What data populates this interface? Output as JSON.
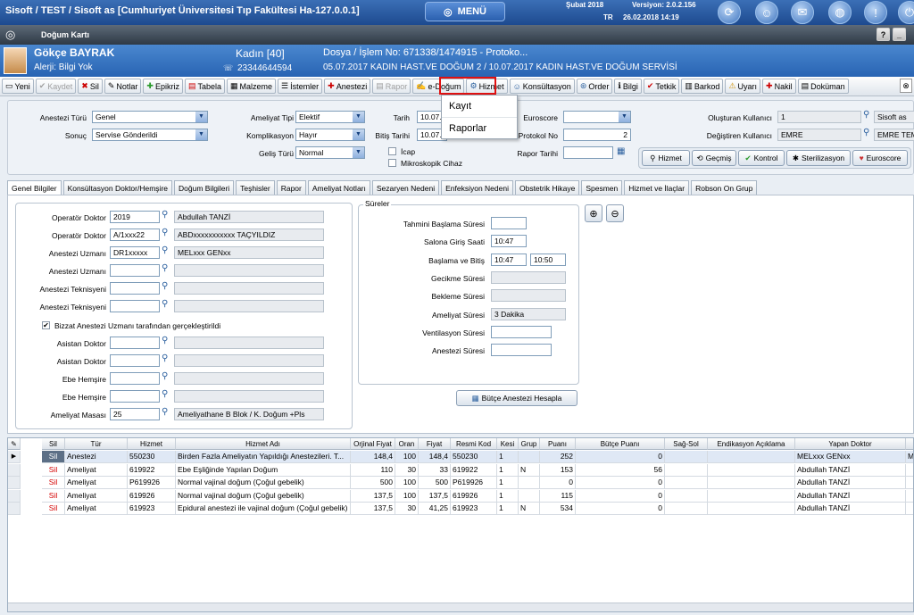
{
  "topbar": {
    "title": "Sisoft / TEST / Sisoft as [Cumhuriyet Üniversitesi Tıp Fakültesi Ha-127.0.0.1]",
    "menu_label": "MENÜ",
    "month": "Şubat 2018",
    "version": "Versiyon: 2.0.2.156",
    "lang": "TR",
    "datetime": "26.02.2018  14:19"
  },
  "window": {
    "title": "Doğum Kartı"
  },
  "patient": {
    "name": "Gökçe BAYRAK",
    "allergy": "Alerji: Bilgi Yok",
    "gender_age": "Kadın [40]",
    "phone": "23344644594",
    "file": "Dosya / İşlem No: 671338/1474915 - Protoko...",
    "service": "05.07.2017 KADIN HAST.VE DOĞUM 2 / 10.07.2017 KADIN HAST.VE DOĞUM SERVİSİ"
  },
  "toolbar": [
    {
      "label": "Yeni",
      "icon": "new-icon",
      "dis": false
    },
    {
      "label": "Kaydet",
      "icon": "save-icon",
      "dis": true
    },
    {
      "label": "Sil",
      "icon": "delete-icon",
      "dis": false
    },
    {
      "label": "Notlar",
      "icon": "notes-icon",
      "dis": false
    },
    {
      "label": "Epikriz",
      "icon": "epicrisis-icon",
      "dis": false
    },
    {
      "label": "Tabela",
      "icon": "chart-icon",
      "dis": false
    },
    {
      "label": "Malzeme",
      "icon": "material-icon",
      "dis": false
    },
    {
      "label": "İstemler",
      "icon": "request-icon",
      "dis": false
    },
    {
      "label": "Anestezi",
      "icon": "anesthesia-icon",
      "dis": false
    },
    {
      "label": "Rapor",
      "icon": "report-icon",
      "dis": true
    },
    {
      "label": "e-Doğum",
      "icon": "edogum-icon",
      "dis": false
    },
    {
      "label": "Hizmet",
      "icon": "service-icon",
      "dis": false
    },
    {
      "label": "Konsültasyon",
      "icon": "consult-icon",
      "dis": false
    },
    {
      "label": "Order",
      "icon": "order-icon",
      "dis": false
    },
    {
      "label": "Bilgi",
      "icon": "info-icon",
      "dis": false
    },
    {
      "label": "Tetkik",
      "icon": "test-icon",
      "dis": false
    },
    {
      "label": "Barkod",
      "icon": "barcode-icon",
      "dis": false
    },
    {
      "label": "Uyarı",
      "icon": "warning-icon",
      "dis": false
    },
    {
      "label": "Nakil",
      "icon": "transfer-icon",
      "dis": false
    },
    {
      "label": "Doküman",
      "icon": "document-icon",
      "dis": false
    }
  ],
  "dropdown": [
    "Kayıt",
    "Raporlar"
  ],
  "form": {
    "anestezi_turu_label": "Anestezi Türü",
    "anestezi_turu": "Genel",
    "sonuc_label": "Sonuç",
    "sonuc": "Servise Gönderildi",
    "ameliyat_tipi_label": "Ameliyat Tipi",
    "ameliyat_tipi": "Elektif",
    "komplikasyon_label": "Komplikasyon",
    "komplikasyon": "Hayır",
    "gelis_turu_label": "Geliş Türü",
    "gelis_turu": "Normal",
    "tarih_label": "Tarih",
    "tarih": "10.07.",
    "bitis_label": "Bitiş Tarihi",
    "bitis": "10.07.",
    "icap": "İcap",
    "mikroskopik": "Mikroskopik Cihaz",
    "euroscore_label": "Euroscore",
    "protokol_label": "Protokol No",
    "protokol": "2",
    "rapor_tarihi_label": "Rapor Tarihi",
    "olusturan_label": "Oluşturan Kullanıcı",
    "olusturan": "1",
    "olusturan_name": "Sisoft as",
    "degistiren_label": "Değiştiren Kullanıcı",
    "degistiren": "EMRE",
    "degistiren_name": "EMRE TEM",
    "buttons": [
      "Hizmet",
      "Geçmiş",
      "Kontrol",
      "Sterilizasyon",
      "Euroscore"
    ]
  },
  "tabs": [
    "Genel Bilgiler",
    "Konsültasyon Doktor/Hemşire",
    "Doğum Bilgileri",
    "Teşhisler",
    "Rapor",
    "Ameliyat Notları",
    "Sezaryen Nedeni",
    "Enfeksiyon Nedeni",
    "Obstetrik Hikaye",
    "Spesmen",
    "Hizmet ve İlaçlar",
    "Robson On Grup"
  ],
  "staff": [
    {
      "label": "Operatör Doktor",
      "code": "2019",
      "name": "Abdullah TANZİ"
    },
    {
      "label": "Operatör Doktor",
      "code": "A/1xxx22",
      "name": "ABDxxxxxxxxxxx TAÇYILDIZ"
    },
    {
      "label": "Anestezi Uzmanı",
      "code": "DR1xxxxx",
      "name": "MELxxx GENxx"
    },
    {
      "label": "Anestezi Uzmanı",
      "code": "",
      "name": ""
    },
    {
      "label": "Anestezi Teknisyeni",
      "code": "",
      "name": ""
    },
    {
      "label": "Anestezi Teknisyeni",
      "code": "",
      "name": ""
    }
  ],
  "bizzat": "Bizzat Anestezi Uzmanı tarafından gerçekleştirildi",
  "staff2": [
    {
      "label": "Asistan Doktor",
      "code": "",
      "name": ""
    },
    {
      "label": "Asistan Doktor",
      "code": "",
      "name": ""
    },
    {
      "label": "Ebe Hemşire",
      "code": "",
      "name": ""
    },
    {
      "label": "Ebe Hemşire",
      "code": "",
      "name": ""
    },
    {
      "label": "Ameliyat Masası",
      "code": "25",
      "name": "Ameliyathane B Blok / K. Doğum +Pls"
    }
  ],
  "sureler": {
    "title": "Süreler",
    "rows": [
      {
        "label": "Tahmini Başlama Süresi",
        "v1": "",
        "v2": null,
        "gray": false,
        "w": 40
      },
      {
        "label": "Salona Giriş Saati",
        "v1": "10:47",
        "v2": null,
        "gray": false,
        "w": 40
      },
      {
        "label": "Başlama ve Bitiş",
        "v1": "10:47",
        "v2": "10:50",
        "gray": false,
        "w": 40
      },
      {
        "label": "Gecikme Süresi",
        "v1": "",
        "v2": null,
        "gray": true,
        "w": 84
      },
      {
        "label": "Bekleme Süresi",
        "v1": "",
        "v2": null,
        "gray": true,
        "w": 84
      },
      {
        "label": "Ameliyat Süresi",
        "v1": "3 Dakika",
        "v2": null,
        "gray": true,
        "w": 84
      },
      {
        "label": "Ventilasyon Süresi",
        "v1": "",
        "v2": null,
        "gray": false,
        "w": 68
      },
      {
        "label": "Anestezi Süresi",
        "v1": "",
        "v2": null,
        "gray": false,
        "w": 68
      }
    ],
    "button": "Bütçe Anestezi Hesapla"
  },
  "grid": {
    "headers": [
      "Sil",
      "Tür",
      "Hizmet",
      "Hizmet Adı",
      "Orjinal Fiyat",
      "Oran",
      "Fiyat",
      "Resmi Kod",
      "Kesi",
      "Grup",
      "Puanı",
      "Bütçe Puanı",
      "Sağ-Sol",
      "Endikasyon Açıklama",
      "Yapan Doktor"
    ],
    "rows": [
      [
        "Sil",
        "Anestezi",
        "550230",
        "Birden Fazla Ameliyatın Yapıldığı Anestezileri. T...",
        "148,4",
        "100",
        "148,4",
        "550230",
        "1",
        "",
        "252",
        "0",
        "",
        "",
        "MELxxx GENxx"
      ],
      [
        "Sil",
        "Ameliyat",
        "619922",
        "Ebe Eşliğinde Yapılan Doğum",
        "110",
        "30",
        "33",
        "619922",
        "1",
        "N",
        "153",
        "56",
        "",
        "",
        "Abdullah TANZİ"
      ],
      [
        "Sil",
        "Ameliyat",
        "P619926",
        "Normal vajinal doğum (Çoğul gebelik)",
        "500",
        "100",
        "500",
        "P619926",
        "1",
        "",
        "0",
        "0",
        "",
        "",
        "Abdullah TANZİ"
      ],
      [
        "Sil",
        "Ameliyat",
        "619926",
        "Normal vajinal doğum (Çoğul gebelik)",
        "137,5",
        "100",
        "137,5",
        "619926",
        "1",
        "",
        "115",
        "0",
        "",
        "",
        "Abdullah TANZİ"
      ],
      [
        "Sil",
        "Ameliyat",
        "619923",
        "Epidural anestezi ile vajinal doğum (Çoğul gebelik)",
        "137,5",
        "30",
        "41,25",
        "619923",
        "1",
        "N",
        "534",
        "0",
        "",
        "",
        "Abdullah TANZİ"
      ]
    ],
    "extra_col": "ME"
  }
}
